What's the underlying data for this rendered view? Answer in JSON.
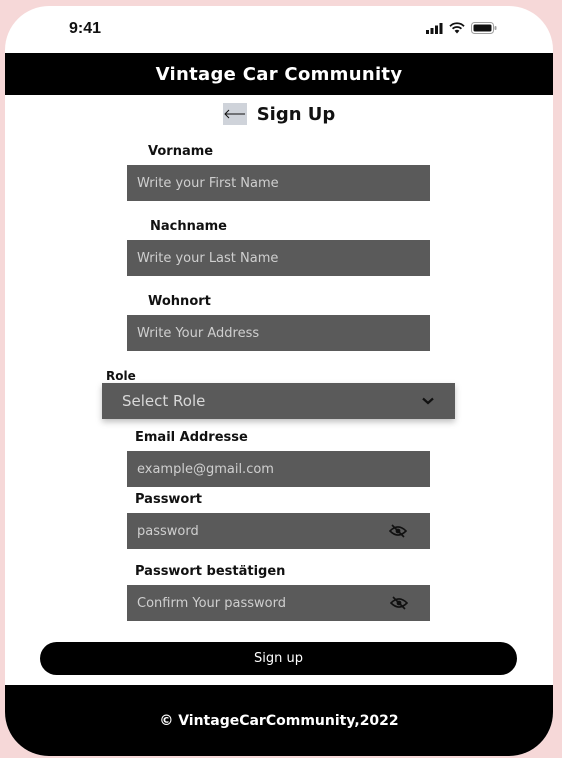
{
  "status_bar": {
    "time": "9:41",
    "icons": [
      "signal-icon",
      "wifi-icon",
      "battery-icon"
    ]
  },
  "header": {
    "title": "Vintage Car Community"
  },
  "page": {
    "title": "Sign Up",
    "back_icon": "back-arrow-icon"
  },
  "form": {
    "first_name": {
      "label": "Vorname",
      "placeholder": "Write your First Name"
    },
    "last_name": {
      "label": "Nachname",
      "placeholder": "Write your Last Name"
    },
    "address": {
      "label": "Wohnort",
      "placeholder": "Write Your Address"
    },
    "role": {
      "label": "Role",
      "selected": "Select Role"
    },
    "email": {
      "label": "Email Addresse",
      "placeholder": "example@gmail.com"
    },
    "password": {
      "label": "Passwort",
      "placeholder": "password"
    },
    "confirm_password": {
      "label": "Passwort bestätigen",
      "placeholder": "Confirm Your password"
    },
    "submit_label": "Sign up"
  },
  "footer": {
    "text": "© VintageCarCommunity,2022"
  },
  "colors": {
    "background": "#f6d8d8",
    "header": "#000000",
    "field": "#5a5a5a",
    "button": "#000000"
  }
}
